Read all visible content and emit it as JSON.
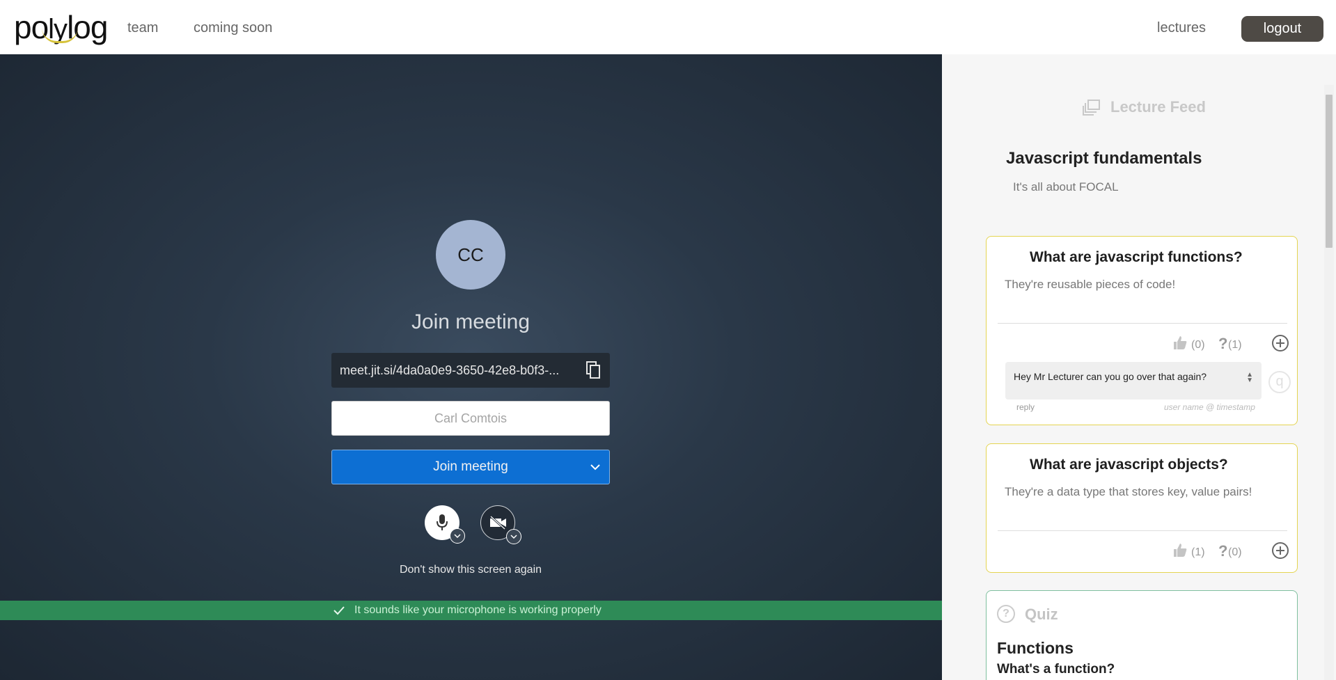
{
  "nav": {
    "logo_text_a": "po",
    "logo_text_b": "ly",
    "logo_text_c": "log",
    "team": "team",
    "coming_soon": "coming soon",
    "lectures": "lectures",
    "logout": "logout"
  },
  "meeting": {
    "avatar_initials": "CC",
    "title": "Join meeting",
    "url": "meet.jit.si/4da0a0e9-3650-42e8-b0f3-...",
    "name_placeholder": "Carl Comtois",
    "join_label": "Join meeting",
    "dont_show": "Don't show this screen again",
    "mic_status": "It sounds like your microphone is working properly"
  },
  "feed": {
    "header": "Lecture Feed",
    "lecture_title": "Javascript fundamentals",
    "lecture_subtitle": "It's all about FOCAL",
    "questions": [
      {
        "title": "What are javascript functions?",
        "answer": "They're reusable pieces of code!",
        "likes": "(0)",
        "confusions": "(1)",
        "comment": "Hey Mr Lecturer can you go over that again?",
        "reply_label": "reply",
        "meta": "user name @ timestamp"
      },
      {
        "title": "What are javascript objects?",
        "answer": "They're a data type that stores key, value pairs!",
        "likes": "(1)",
        "confusions": "(0)"
      }
    ],
    "quiz": {
      "label": "Quiz",
      "heading": "Functions",
      "question": "What's a function?"
    }
  },
  "colors": {
    "accent": "#0d6fd3",
    "success": "#2e8b57",
    "card_border": "#e4d451",
    "quiz_border": "#7fbf9e",
    "logout_bg": "#4e4a45"
  }
}
